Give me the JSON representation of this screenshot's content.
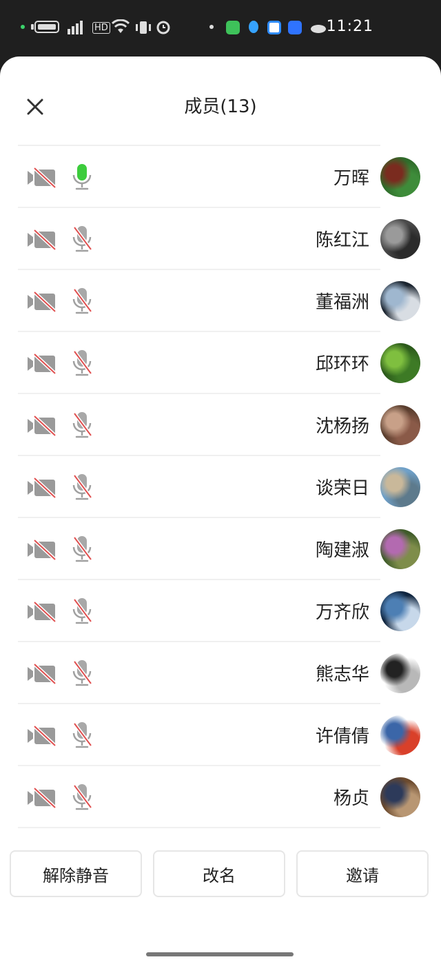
{
  "status_bar": {
    "time": "11:21",
    "network_label": "HD"
  },
  "sheet": {
    "title": "成员(13)"
  },
  "members": [
    {
      "name": "万晖",
      "mic": "on",
      "camera": "off",
      "avatar_colors": [
        "#2f6b2a",
        "#7a2b1f",
        "#3e8c3a"
      ]
    },
    {
      "name": "陈红江",
      "mic": "off",
      "camera": "off",
      "avatar_colors": [
        "#4a4a4a",
        "#9a9a9a",
        "#2b2b2b"
      ]
    },
    {
      "name": "董福洲",
      "mic": "off",
      "camera": "off",
      "avatar_colors": [
        "#1c2530",
        "#9fb7cf",
        "#d8dde3"
      ]
    },
    {
      "name": "邱环环",
      "mic": "off",
      "camera": "off",
      "avatar_colors": [
        "#2c5a1b",
        "#7fbf3f",
        "#3d7a25"
      ]
    },
    {
      "name": "沈杨扬",
      "mic": "off",
      "camera": "off",
      "avatar_colors": [
        "#5a3e2e",
        "#c8a088",
        "#8a5a48"
      ]
    },
    {
      "name": "谈荣日",
      "mic": "off",
      "camera": "off",
      "avatar_colors": [
        "#6fa0c8",
        "#c9b89a",
        "#5d7a8c"
      ]
    },
    {
      "name": "陶建淑",
      "mic": "off",
      "camera": "off",
      "avatar_colors": [
        "#3f5b2a",
        "#b36ab0",
        "#7e8d4a"
      ]
    },
    {
      "name": "万齐欣",
      "mic": "off",
      "camera": "off",
      "avatar_colors": [
        "#10253f",
        "#4d7fb4",
        "#c7d8ea"
      ]
    },
    {
      "name": "熊志华",
      "mic": "off",
      "camera": "off",
      "avatar_colors": [
        "#ffffff",
        "#222222",
        "#b8b8b8"
      ]
    },
    {
      "name": "许倩倩",
      "mic": "off",
      "camera": "off",
      "avatar_colors": [
        "#ffffff",
        "#3b66a8",
        "#d9402a"
      ]
    },
    {
      "name": "杨贞",
      "mic": "off",
      "camera": "off",
      "avatar_colors": [
        "#6b4a2e",
        "#2d3a5a",
        "#b89672"
      ]
    }
  ],
  "actions": {
    "unmute_all": "解除静音",
    "rename": "改名",
    "invite": "邀请"
  },
  "colors": {
    "mic_on": "#3ccc3c",
    "muted_slash": "#e05050",
    "icon_gray": "#a8a8a8"
  }
}
